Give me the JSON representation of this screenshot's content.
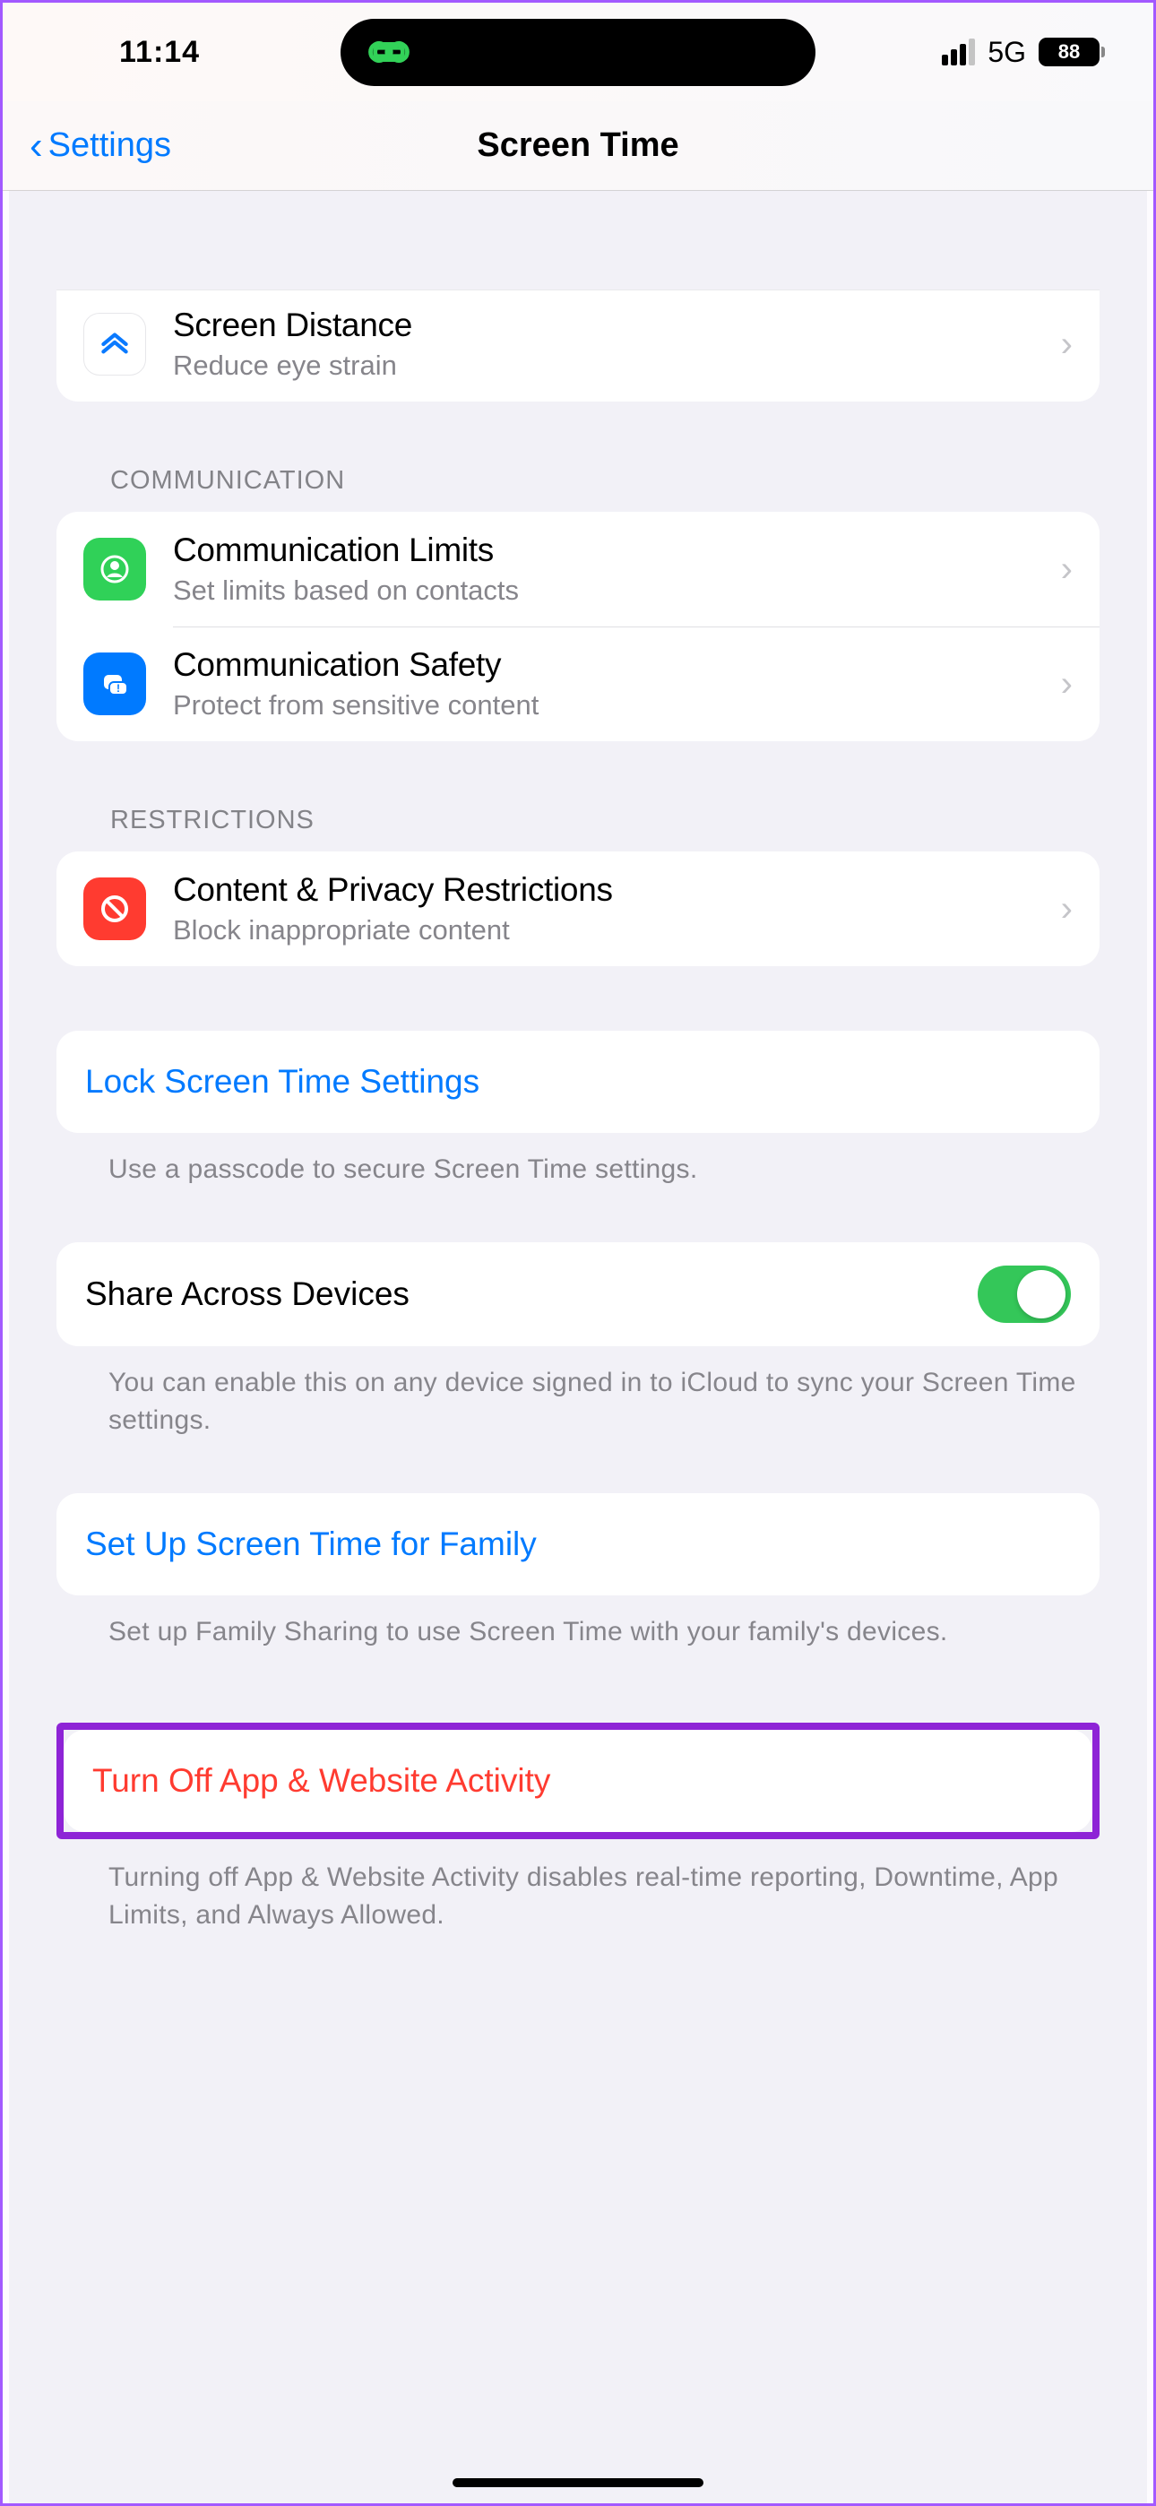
{
  "statusBar": {
    "time": "11:14",
    "network": "5G",
    "battery": "88"
  },
  "nav": {
    "back": "Settings",
    "title": "Screen Time"
  },
  "screenDistance": {
    "title": "Screen Distance",
    "subtitle": "Reduce eye strain"
  },
  "communication": {
    "header": "Communication",
    "limits": {
      "title": "Communication Limits",
      "subtitle": "Set limits based on contacts"
    },
    "safety": {
      "title": "Communication Safety",
      "subtitle": "Protect from sensitive content"
    }
  },
  "restrictions": {
    "header": "Restrictions",
    "privacy": {
      "title": "Content & Privacy Restrictions",
      "subtitle": "Block inappropriate content"
    }
  },
  "lock": {
    "label": "Lock Screen Time Settings",
    "footer": "Use a passcode to secure Screen Time settings."
  },
  "share": {
    "label": "Share Across Devices",
    "footer": "You can enable this on any device signed in to iCloud to sync your Screen Time settings."
  },
  "family": {
    "label": "Set Up Screen Time for Family",
    "footer": "Set up Family Sharing to use Screen Time with your family's devices."
  },
  "turnOff": {
    "label": "Turn Off App & Website Activity",
    "footer": "Turning off App & Website Activity disables real-time reporting, Downtime, App Limits, and Always Allowed."
  }
}
